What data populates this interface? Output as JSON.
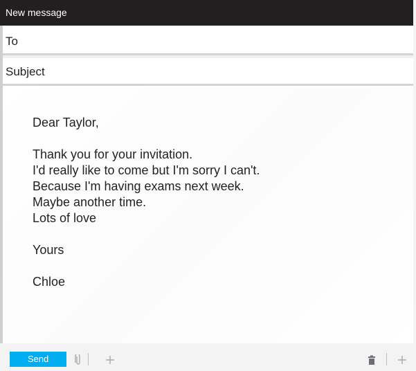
{
  "window": {
    "title": "New message"
  },
  "fields": {
    "to_label": "To",
    "subject_label": "Subject"
  },
  "body": {
    "greeting": "Dear Taylor,",
    "lines": [
      "Thank you for your invitation.",
      "I'd really like to come but I'm sorry I can't.",
      "Because I'm having exams next week.",
      "Maybe another time.",
      "Lots of love"
    ],
    "closing": "Yours",
    "signature": "Chloe"
  },
  "toolbar": {
    "send_label": "Send",
    "icons": [
      "attachment-icon",
      "add-icon",
      "trash-icon",
      "add-icon"
    ]
  },
  "colors": {
    "titlebar": "#231f20",
    "send_button": "#00aeef",
    "toolbar": "#f3f3f3"
  }
}
